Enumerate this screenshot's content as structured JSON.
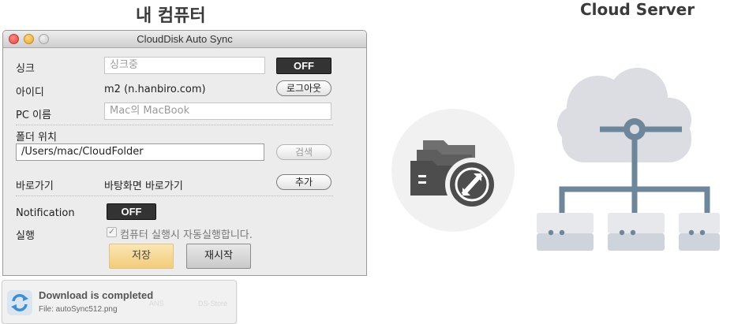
{
  "headings": {
    "left": "내 컴퓨터",
    "right": "Cloud Server"
  },
  "window": {
    "title": "CloudDisk Auto Sync",
    "sync": {
      "label": "싱크",
      "status": "싱크중",
      "toggle": "OFF"
    },
    "id_row": {
      "label": "아이디",
      "value": "m2 (n.hanbiro.com)",
      "logout": "로그아웃"
    },
    "pc_name": {
      "label": "PC 이름",
      "value": "Mac의 MacBook"
    },
    "folder": {
      "label": "폴더 위치",
      "path": "/Users/mac/CloudFolder",
      "browse": "검색"
    },
    "shortcut": {
      "label": "바로가기",
      "value": "바탕화면 바로가기",
      "add": "추가"
    },
    "notification": {
      "label": "Notification",
      "toggle": "OFF"
    },
    "run": {
      "label": "실행",
      "checkbox_label": "컴퓨터 실행시 자동실행합니다.",
      "checked": true
    },
    "buttons": {
      "save": "저장",
      "restart": "재시작"
    }
  },
  "toast": {
    "title": "Download is completed",
    "subtitle": "File: autoSync512.png",
    "ghost_a": "ANS",
    "ghost_b": "DS-Store"
  },
  "colors": {
    "dark_button": "#333333",
    "save_button": "#f2cc7a",
    "cloud": "#dcdde3",
    "server": "#cfd3dc",
    "connector": "#6e8699"
  },
  "icons": [
    "folder-sync-icon",
    "cloud-server-icon",
    "sync-icon"
  ]
}
